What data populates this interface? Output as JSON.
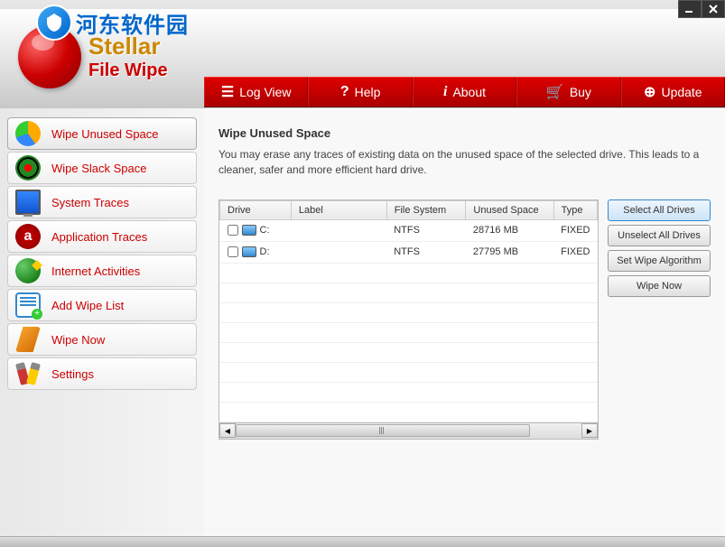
{
  "watermark": {
    "text": "河东软件园"
  },
  "app": {
    "name1": "Stellar",
    "name2": "File Wipe"
  },
  "toolbar": {
    "logview": "Log View",
    "help": "Help",
    "about": "About",
    "buy": "Buy",
    "update": "Update"
  },
  "sidebar": {
    "items": [
      {
        "label": "Wipe Unused Space"
      },
      {
        "label": "Wipe Slack Space"
      },
      {
        "label": "System Traces"
      },
      {
        "label": "Application Traces"
      },
      {
        "label": "Internet Activities"
      },
      {
        "label": "Add Wipe List"
      },
      {
        "label": "Wipe Now"
      },
      {
        "label": "Settings"
      }
    ]
  },
  "content": {
    "title": "Wipe Unused Space",
    "description": "You may erase any traces of existing data on the  unused space of the selected drive. This leads to a cleaner, safer and more efficient hard drive."
  },
  "table": {
    "headers": {
      "drive": "Drive",
      "label": "Label",
      "fs": "File System",
      "unused": "Unused Space",
      "type": "Type"
    },
    "rows": [
      {
        "drive": "C:",
        "label": "",
        "fs": "NTFS",
        "unused": "28716  MB",
        "type": "FIXED"
      },
      {
        "drive": "D:",
        "label": "",
        "fs": "NTFS",
        "unused": "27795  MB",
        "type": "FIXED"
      }
    ]
  },
  "actions": {
    "selectAll": "Select All Drives",
    "unselectAll": "Unselect All Drives",
    "algorithm": "Set Wipe Algorithm",
    "wipeNow": "Wipe Now"
  }
}
